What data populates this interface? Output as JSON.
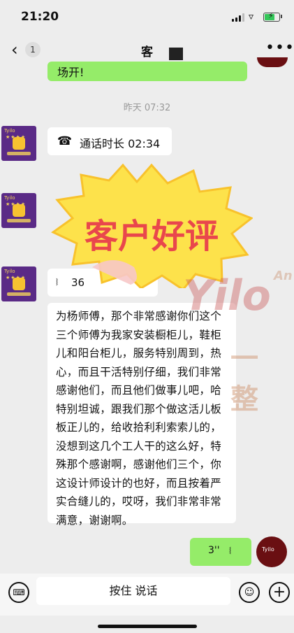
{
  "status": {
    "time": "21:20"
  },
  "nav": {
    "unread": "1",
    "title": "客"
  },
  "messages": {
    "prev_tail": "场开!",
    "timestamp": "昨天 07:32",
    "call": "通话时长 02:34",
    "voice_left": "36",
    "long_text": "为杨师傅，那个非常感谢你们这个三个师傅为我家安装橱柜儿，鞋柜儿和阳台柜儿，服务特别周到，热心，而且干活特别仔细，我们非常感谢他们，而且他们做事儿吧，哈特别坦诚，跟我们那个做这活儿板板正儿的，给收拾利利索索儿的，没想到这几个工人干的这么好，特殊那个感谢啊，感谢他们三个，你这设计师设计的也好，而且按着严实合缝儿的，哎呀，我们非常非常满意，谢谢啊。",
    "voice_right": "3''"
  },
  "promo": {
    "text": "客户好评"
  },
  "watermark": {
    "brand": "Yilo",
    "suffix": "An",
    "cn": "一 整"
  },
  "input": {
    "talk": "按住 说话"
  },
  "colors": {
    "green": "#95ec69",
    "accent": "#e9474c",
    "avatar": "#5a2a86"
  }
}
